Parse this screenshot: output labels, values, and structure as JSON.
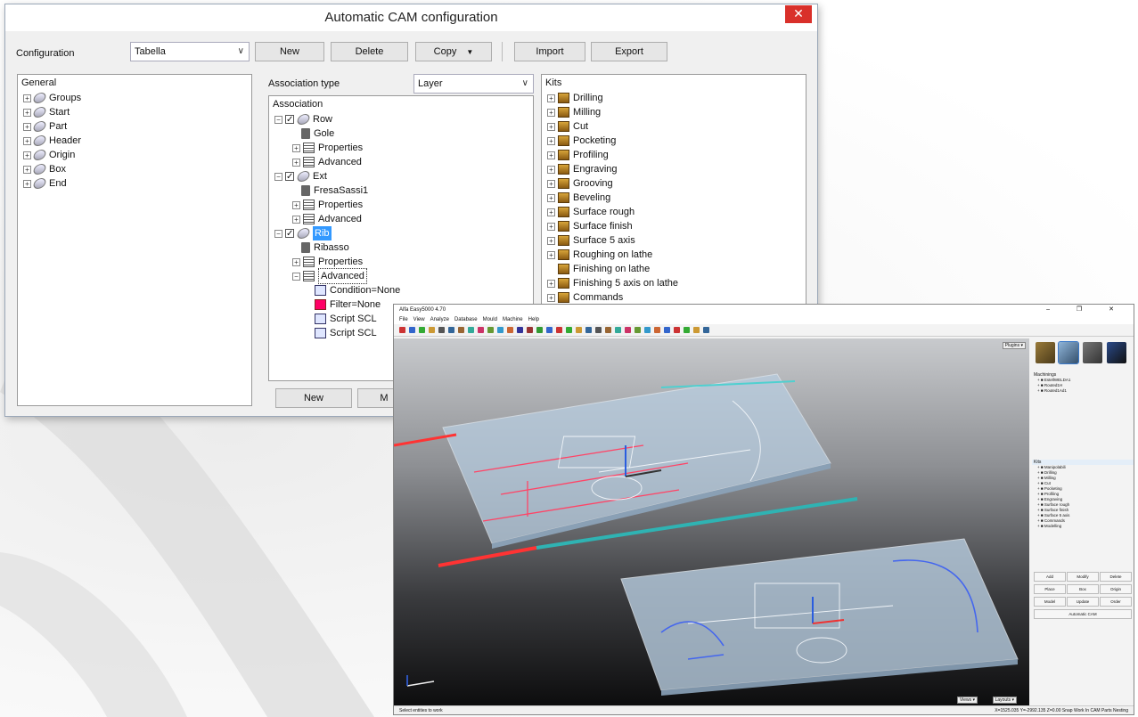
{
  "dialog": {
    "title": "Automatic CAM configuration",
    "close_glyph": "✕",
    "configuration_label": "Configuration",
    "configuration_value": "Tabella",
    "buttons": {
      "new": "New",
      "delete": "Delete",
      "copy": "Copy",
      "import": "Import",
      "export": "Export"
    },
    "general": {
      "title": "General",
      "items": [
        "Groups",
        "Start",
        "Part",
        "Header",
        "Origin",
        "Box",
        "End"
      ]
    },
    "association": {
      "type_label": "Association type",
      "type_value": "Layer",
      "panel_title": "Association",
      "tree": {
        "row": "Row",
        "row_tool": "Gole",
        "properties": "Properties",
        "advanced": "Advanced",
        "ext": "Ext",
        "ext_tool": "FresaSassi1",
        "rib": "Rib",
        "rib_tool": "Ribasso",
        "condition": "Condition=None",
        "filter": "Filter=None",
        "script1": "Script SCL",
        "script2": "Script SCL"
      },
      "bottom_new": "New",
      "bottom_m": "M"
    },
    "kits": {
      "title": "Kits",
      "items": [
        "Drilling",
        "Milling",
        "Cut",
        "Pocketing",
        "Profiling",
        "Engraving",
        "Grooving",
        "Beveling",
        "Surface rough",
        "Surface finish",
        "Surface 5 axis",
        "Roughing on lathe",
        "Finishing on lathe",
        "Finishing 5 axis on lathe",
        "Commands"
      ]
    }
  },
  "app": {
    "title": "Alfa Easy5000 4.70",
    "window_controls": "–  ❐  ✕",
    "menu": [
      "File",
      "View",
      "Analyze",
      "Database",
      "Mould",
      "Machine",
      "Help"
    ],
    "viewport_dropdown": "Plugins",
    "viewport_bottom_left": "Views",
    "viewport_bottom_right": "Layouts",
    "status_left": "Select entities to work",
    "status_right": "X=1525.035 Y=-2992.135 Z=0.00    Snap    Work  In    CAM Parts Nesting",
    "side": {
      "machinings_label": "Machinings",
      "machinings": [
        "EstellWELDA1",
        "Routed1H",
        "Routed1Ad1"
      ],
      "kits_label": "Kits",
      "kits": [
        "Manipolabili",
        "Drilling",
        "Milling",
        "Cut",
        "Pocketing",
        "Profiling",
        "Engraving",
        "Surface rough",
        "Surface finish",
        "Surface 5 axis",
        "Commands",
        "Modelling"
      ],
      "buttons": {
        "add": "Add",
        "modify": "Modify",
        "delete": "Delete",
        "place": "Place",
        "box": "Box",
        "origin": "Origin",
        "model": "Model",
        "update": "Update",
        "order": "Order",
        "auto_cam": "Automatic CAM"
      }
    }
  }
}
